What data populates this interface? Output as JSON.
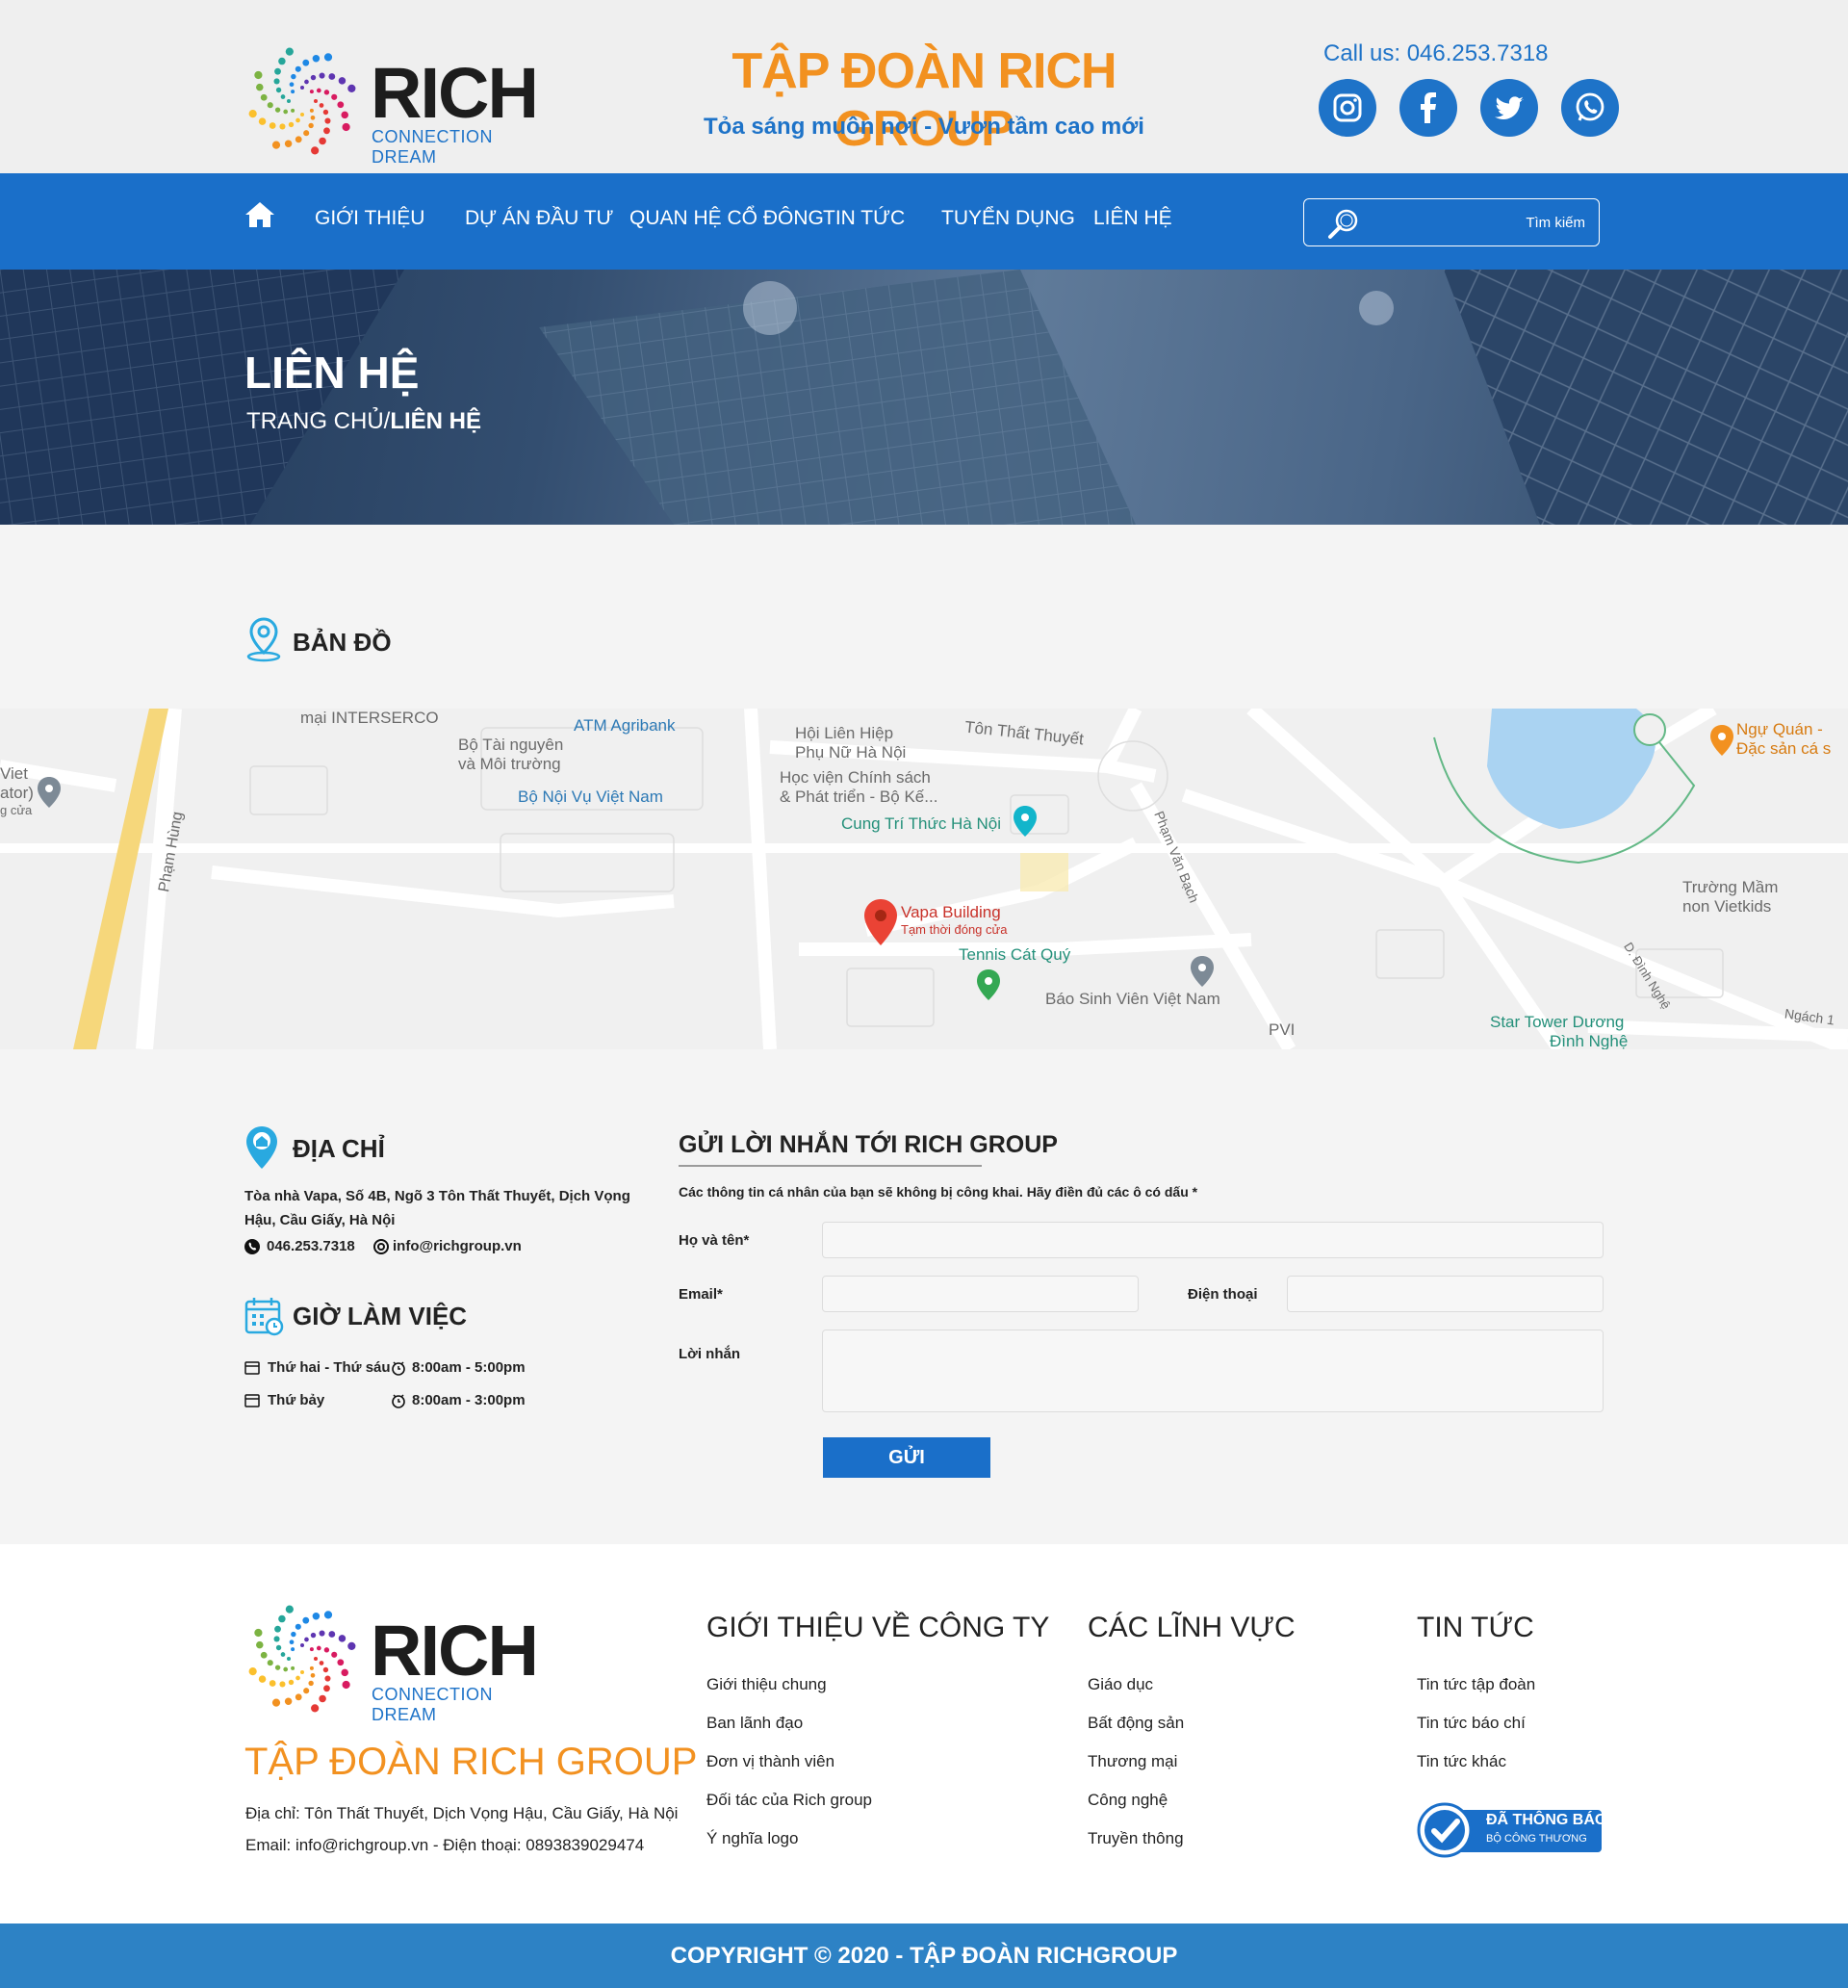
{
  "header": {
    "logo_word": "RICH",
    "logo_tagline": "CONNECTION DREAM",
    "company_title": "TẬP ĐOÀN RICH GROUP",
    "slogan": "Tỏa sáng muôn nơi - Vươn tầm cao mới",
    "call_us": "Call us: 046.253.7318",
    "social": [
      "instagram-icon",
      "facebook-icon",
      "twitter-icon",
      "whatsapp-icon"
    ]
  },
  "nav": {
    "items": [
      "GIỚI THIỆU",
      "DỰ ÁN ĐẦU TƯ",
      "QUAN HỆ CỔ ĐÔNG",
      "TIN TỨC",
      "TUYỂN DỤNG",
      "LIÊN HỆ"
    ],
    "search_placeholder": "Tìm kiếm"
  },
  "banner": {
    "title": "LIÊN HỆ",
    "breadcrumb_home": "TRANG CHỦ/",
    "breadcrumb_current": "LIÊN HỆ"
  },
  "map": {
    "heading": "BẢN ĐỒ",
    "labels": {
      "interserco": "mại INTERSERCO",
      "atm": "ATM Agribank",
      "tainguyen1": "Bộ Tài nguyên",
      "tainguyen2": "và Môi trường",
      "noivu": "Bộ Nội Vụ Việt Nam",
      "hoilienhiep1": "Hội Liên Hiệp",
      "hoilienhiep2": "Phụ Nữ Hà Nội",
      "tonthatthuyet": "Tôn Thất Thuyết",
      "hocvien1": "Học viện Chính sách",
      "hocvien2": "& Phát triển - Bộ Kế...",
      "cungtrithuc": "Cung Trí Thức Hà Nội",
      "phamhung": "Phạm Hùng",
      "phamvanbach": "Phạm Văn Bạch",
      "vapa": "Vapa Building",
      "vapa_status": "Tạm thời đóng cửa",
      "tennis": "Tennis Cát Quý",
      "baosinhvien": "Báo Sinh Viên Việt Nam",
      "pvi": "PVI",
      "nguquan1": "Ngự Quán -",
      "nguquan2": "Đặc sản cá s",
      "mamnon1": "Trường Mầm",
      "mamnon2": "non Vietkids",
      "dinhnghe": "D. Đình Nghệ",
      "startower1": "Star Tower Dương",
      "startower2": "Đình Nghệ",
      "ngach": "Ngách 1",
      "viet": "Viet",
      "ator": "ator)",
      "gcua": "g cửa"
    }
  },
  "address": {
    "title": "ĐỊA CHỈ",
    "line1": "Tòa nhà Vapa, Số 4B, Ngõ 3 Tôn Thất Thuyết, Dịch Vọng",
    "line2": "Hậu, Cầu Giấy, Hà Nội",
    "phone": "046.253.7318",
    "email": "info@richgroup.vn"
  },
  "hours": {
    "title": "GIỜ LÀM VIỆC",
    "rows": [
      {
        "day": "Thứ hai - Thứ sáu",
        "time": "8:00am - 5:00pm"
      },
      {
        "day": "Thứ bảy",
        "time": "8:00am - 3:00pm"
      }
    ]
  },
  "form": {
    "title": "GỬI LỜI NHẮN TỚI RICH GROUP",
    "note": "Các thông tin cá nhân của bạn sẽ không bị công khai. Hãy điền đủ các ô có dấu *",
    "name_label": "Họ và tên*",
    "email_label": "Email*",
    "phone_label": "Điện thoại",
    "message_label": "Lời nhắn",
    "submit": "GỬI"
  },
  "footer": {
    "company": "TẬP ĐOÀN RICH GROUP",
    "address": "Địa chỉ: Tôn Thất Thuyết, Dịch Vọng Hậu, Cầu Giấy, Hà Nội",
    "contact": "Email: info@richgroup.vn - Điện thoại: 0893839029474",
    "col1": {
      "title": "GIỚI THIỆU VỀ CÔNG TY",
      "links": [
        "Giới thiệu chung",
        "Ban lãnh đạo",
        "Đơn vị thành viên",
        "Đối tác của Rich group",
        "Ý nghĩa logo"
      ]
    },
    "col2": {
      "title": "CÁC LĨNH VỰC",
      "links": [
        "Giáo dục",
        "Bất động sản",
        "Thương mại",
        "Công nghệ",
        "Truyền thông"
      ]
    },
    "col3": {
      "title": "TIN TỨC",
      "links": [
        "Tin tức tập đoàn",
        "Tin tức báo chí",
        "Tin tức khác"
      ]
    },
    "badge_line1": "ĐÃ THÔNG BÁO",
    "badge_line2": "BỘ CÔNG THƯƠNG",
    "copyright": "COPYRIGHT © 2020 - TẬP ĐOÀN RICHGROUP"
  },
  "colors": {
    "brand_blue": "#1a6fc9",
    "brand_orange": "#f29120"
  }
}
